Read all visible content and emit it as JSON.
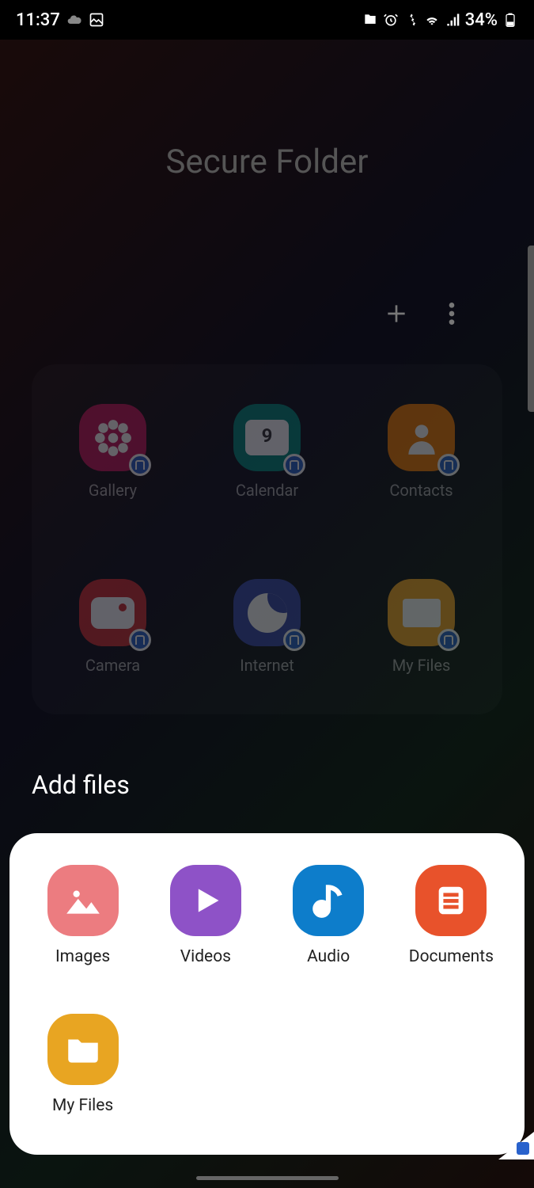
{
  "status": {
    "time": "11:37",
    "battery": "34%"
  },
  "page_title": "Secure Folder",
  "calendar_day": "9",
  "apps": [
    {
      "label": "Gallery",
      "icon": "gallery"
    },
    {
      "label": "Calendar",
      "icon": "calendar"
    },
    {
      "label": "Contacts",
      "icon": "contacts"
    },
    {
      "label": "Camera",
      "icon": "camera"
    },
    {
      "label": "Internet",
      "icon": "internet"
    },
    {
      "label": "My Files",
      "icon": "myfiles"
    }
  ],
  "sheet": {
    "title": "Add files",
    "items": [
      {
        "label": "Images",
        "icon": "images"
      },
      {
        "label": "Videos",
        "icon": "videos"
      },
      {
        "label": "Audio",
        "icon": "audio"
      },
      {
        "label": "Documents",
        "icon": "documents"
      },
      {
        "label": "My Files",
        "icon": "myfiles"
      }
    ]
  }
}
